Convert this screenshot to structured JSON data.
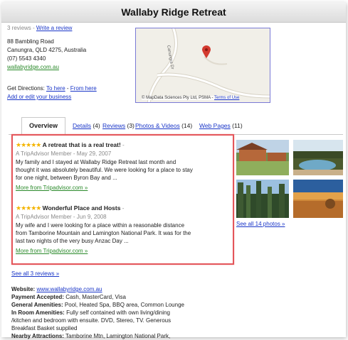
{
  "title": "Wallaby Ridge Retreat",
  "summary": {
    "reviews_count": "3 reviews",
    "separator": " - ",
    "write_review": "Write a review"
  },
  "address": {
    "line1": "88 Bambling Road",
    "line2": "Canungra, QLD 4275, Australia",
    "phone": "(07) 5543 4340",
    "site": "wallabyridge.com.au"
  },
  "directions": {
    "label": "Get Directions: ",
    "to_here": "To here",
    "sep": " - ",
    "from_here": "From here",
    "edit": "Add or edit your business"
  },
  "map": {
    "road_label_1": "Canungra Dr",
    "attribution": "© MapData Sciences Pty Ltd, PSMA",
    "terms": "Terms of Use"
  },
  "tabs": [
    {
      "label": "Overview",
      "count": ""
    },
    {
      "label": "Details",
      "count": " (4)"
    },
    {
      "label": "Reviews",
      "count": " (3)"
    },
    {
      "label": "Photos & Videos",
      "count": " (14)"
    },
    {
      "label": "Web Pages",
      "count": " (11)"
    }
  ],
  "reviews": [
    {
      "stars": "★★★★★",
      "title": "A retreat that is a real treat!",
      "dash": " -",
      "byline": "A TripAdvisor Member - May 29, 2007",
      "body1": "My family and I stayed at Wallaby Ridge Retreat last month and",
      "body2": "thought it was absolutely beautiful. We were looking for a place to stay",
      "body3": "for one night, between Byron Bay and ...",
      "more": "More from Tripadvisor.com »"
    },
    {
      "stars": "★★★★★",
      "title": "Wonderful Place and Hosts",
      "dash": " -",
      "byline": "A TripAdvisor Member - Jun 9, 2008",
      "body1": "My wife and I were looking for a place within a reasonable distance",
      "body2": "from Tamborine Mountain and Lamington National Park. It was for the",
      "body3": "last two nights of the very busy Anzac Day ...",
      "more": "More from Tripadvisor.com »"
    }
  ],
  "photos_link": "See all 14 photos »",
  "see_all_reviews": "See all 3 reviews »",
  "details": {
    "website_label": "Website:",
    "website": "www.wallabyridge.com.au",
    "payment_label": "Payment Accepted:",
    "payment": "Cash, MasterCard, Visa",
    "general_label": "General Amenities:",
    "general": "Pool, Heated Spa, BBQ area, Common Lounge",
    "room_label": "In Room Amenities:",
    "room1": "Fully self contained with own living/dining",
    "room2": "/kitchen and bedroom with ensuite. DVD, Stereo, TV. Generous",
    "room3": "Breakfast Basket supplied",
    "nearby_label": "Nearby Attractions:",
    "nearby": "Tamborine Mtn, Lamington National Park,"
  },
  "colors": {
    "link": "#1a36c8",
    "green": "#2a8a2a",
    "highlight": "#e4565a",
    "star": "#f4b400",
    "pin": "#d33a2f"
  }
}
